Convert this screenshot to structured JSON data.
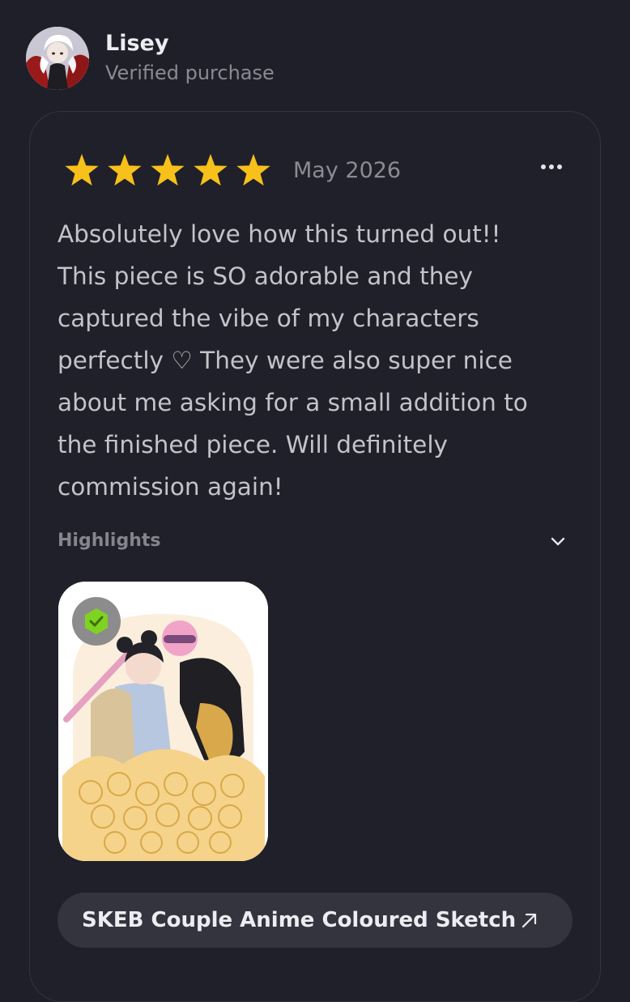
{
  "reviewer": {
    "name": "Lisey",
    "status": "Verified purchase",
    "avatar_icon": "avatar-image"
  },
  "review": {
    "rating": 5,
    "rating_max": 5,
    "star_color": "#f7c01a",
    "date": "May 2026",
    "more_icon": "more-horizontal-icon",
    "text": "Absolutely love how this turned out!!\nThis piece is SO adorable and they\ncaptured the vibe of my characters\nperfectly ♡ They were also super nice\nabout me asking for a small addition to\nthe finished piece. Will definitely\ncommission again!",
    "highlights_label": "Highlights",
    "highlights_icon": "chevron-down-icon"
  },
  "attachment": {
    "badge_icon": "verified-check-icon",
    "badge_color": "#7ed321"
  },
  "product": {
    "title": "SKEB Couple Anime Coloured Sketch",
    "link_icon": "arrow-up-right-icon"
  }
}
